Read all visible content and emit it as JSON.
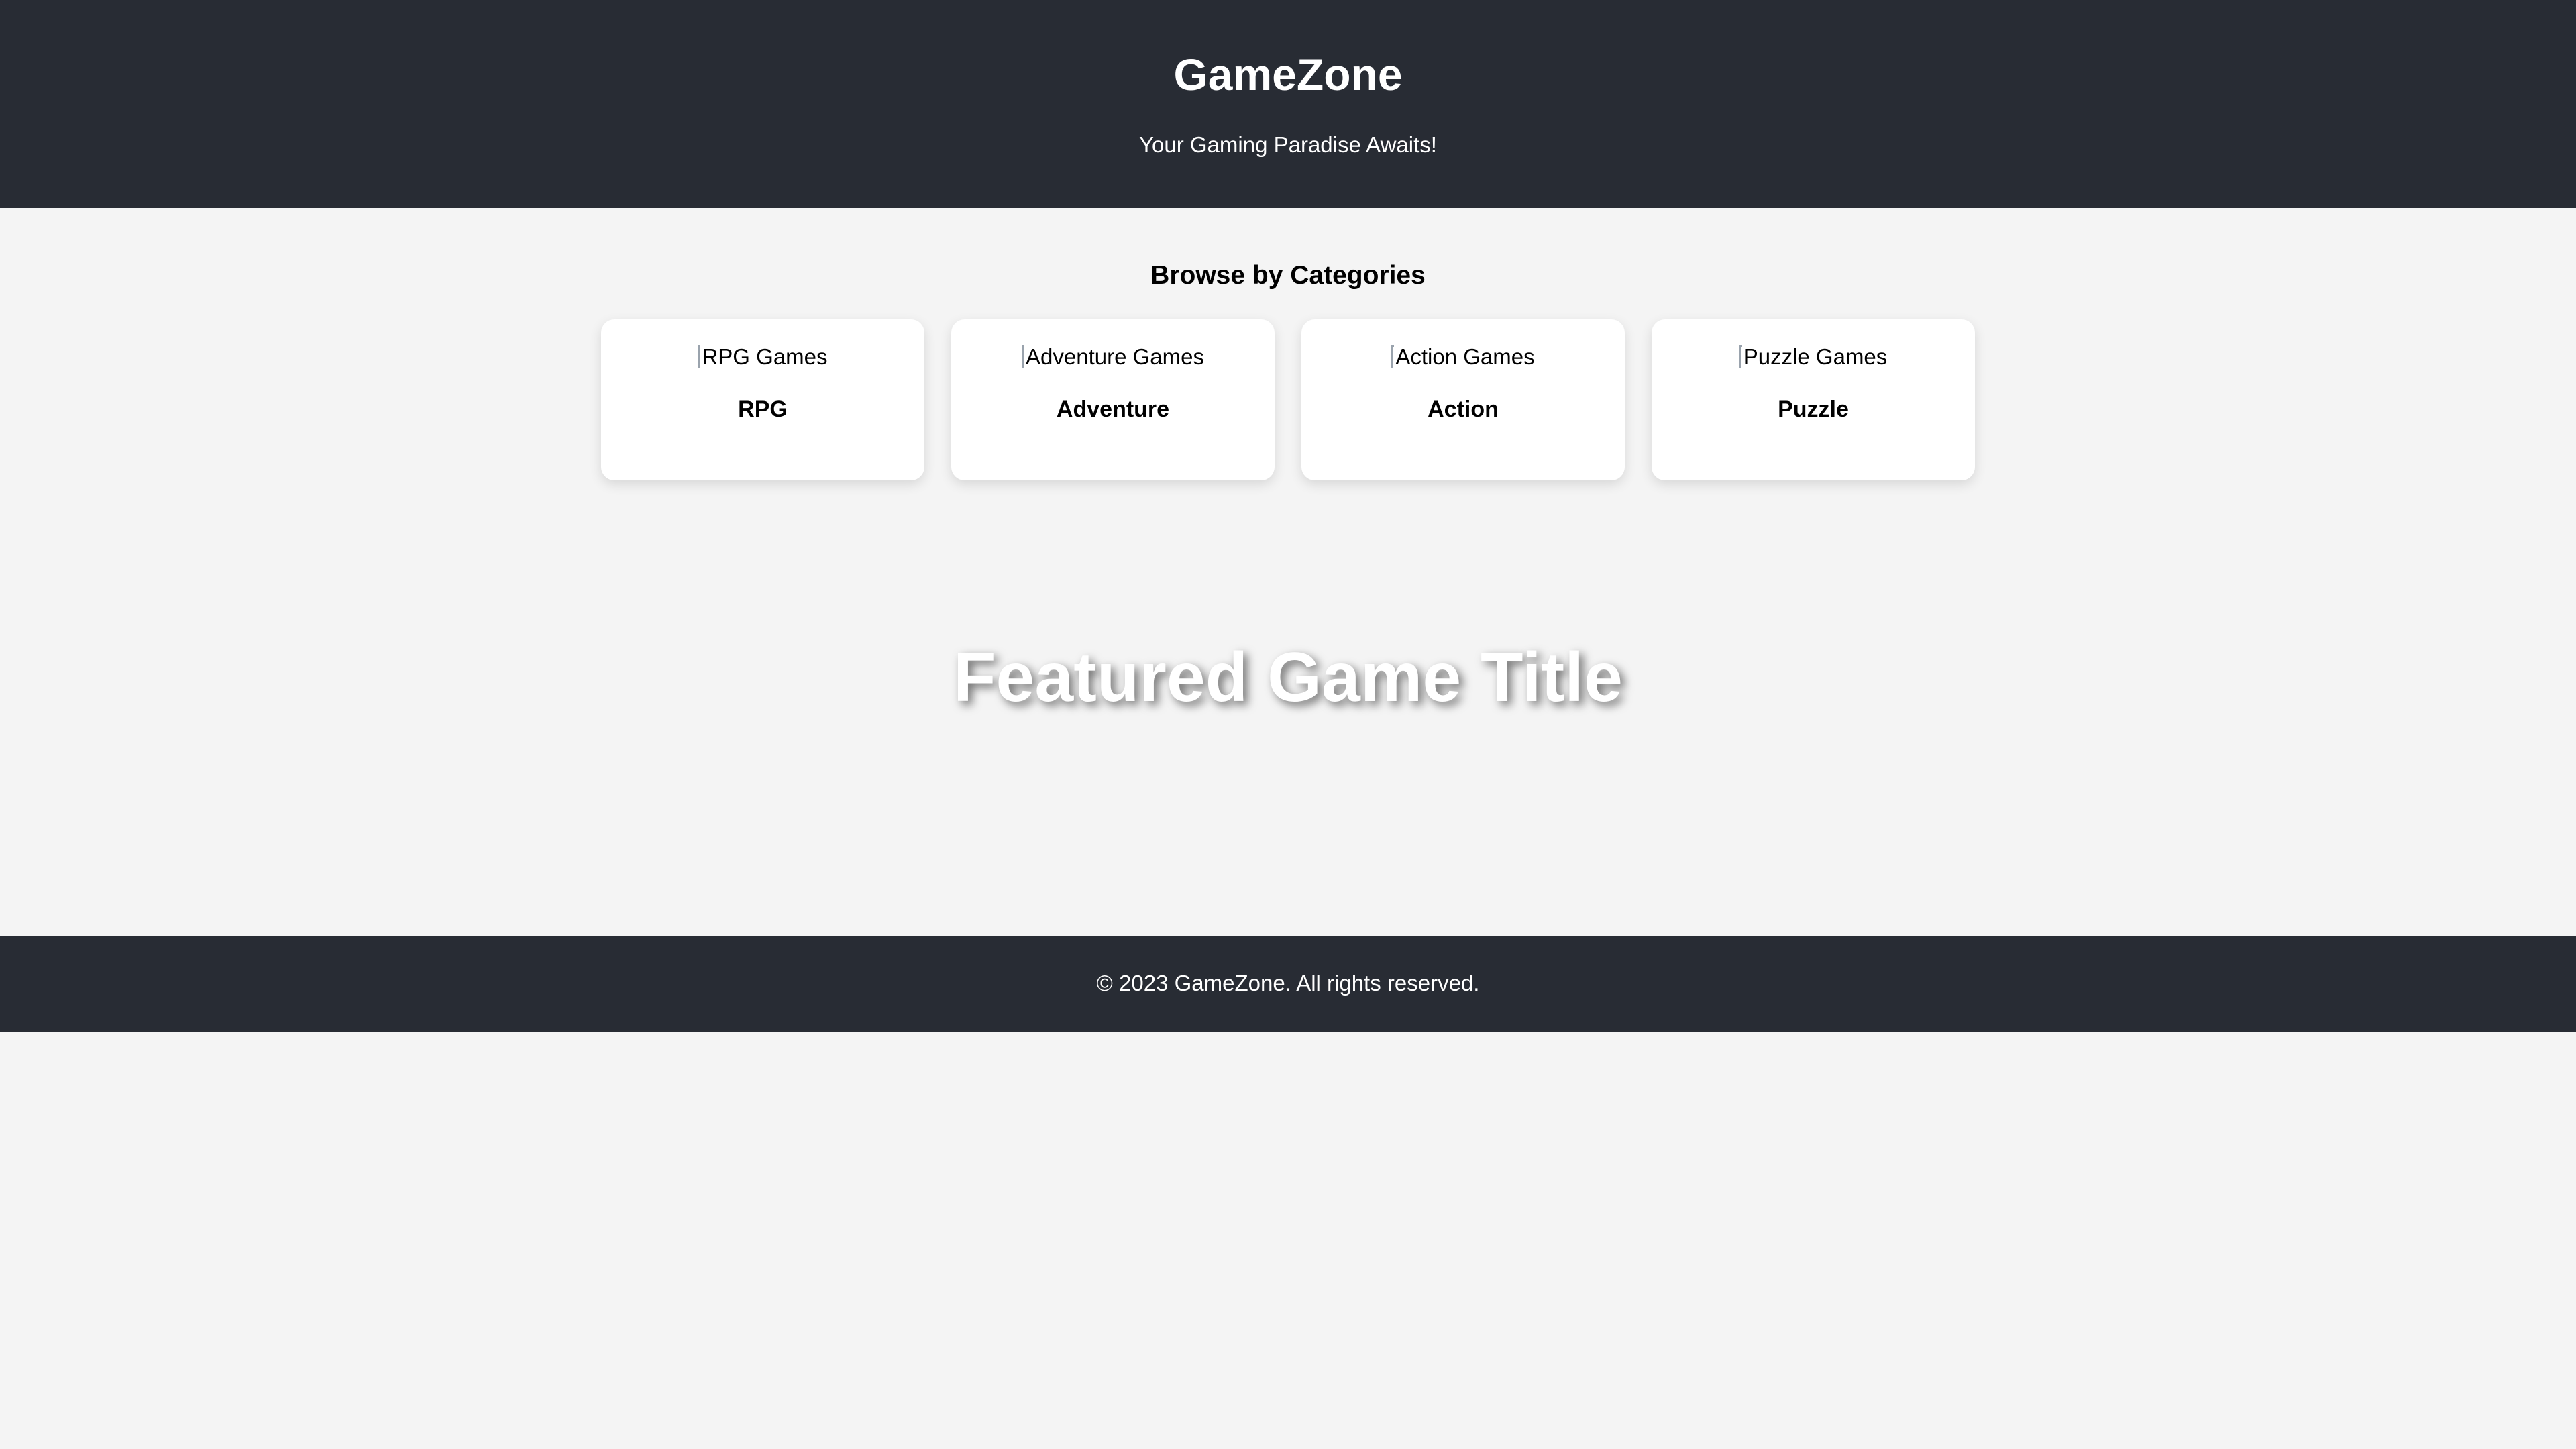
{
  "header": {
    "title": "GameZone",
    "tagline": "Your Gaming Paradise Awaits!"
  },
  "categories": {
    "heading": "Browse by Categories",
    "items": [
      {
        "image_alt": "RPG Games",
        "label": "RPG"
      },
      {
        "image_alt": "Adventure Games",
        "label": "Adventure"
      },
      {
        "image_alt": "Action Games",
        "label": "Action"
      },
      {
        "image_alt": "Puzzle Games",
        "label": "Puzzle"
      }
    ]
  },
  "featured": {
    "title": "Featured Game Title"
  },
  "footer": {
    "text": "© 2023 GameZone. All rights reserved."
  },
  "colors": {
    "header_bg": "#282c34",
    "page_bg": "#f4f4f4",
    "card_bg": "#ffffff"
  },
  "icons": {
    "category_image": "broken-image-icon"
  }
}
